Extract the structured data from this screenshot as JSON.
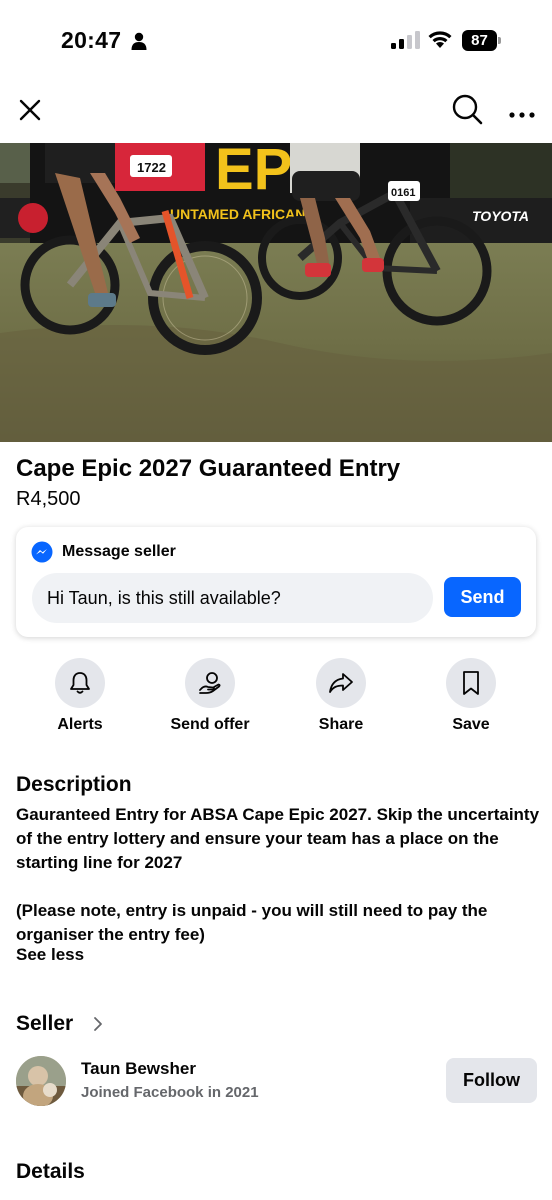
{
  "status_bar": {
    "time": "20:47",
    "battery": "87"
  },
  "listing": {
    "title": "Cape Epic 2027 Guaranteed Entry",
    "price": "R4,500"
  },
  "message_seller": {
    "title": "Message seller",
    "input_value": "Hi Taun, is this still available?",
    "send_label": "Send"
  },
  "actions": [
    {
      "label": "Alerts",
      "icon": "bell-icon"
    },
    {
      "label": "Send offer",
      "icon": "send-offer-icon"
    },
    {
      "label": "Share",
      "icon": "share-icon"
    },
    {
      "label": "Save",
      "icon": "bookmark-icon"
    }
  ],
  "description": {
    "heading": "Description",
    "paragraph_1": "Gauranteed Entry for ABSA Cape Epic 2027. Skip the uncertainty of the entry lottery and ensure your team has a place on the starting line for 2027",
    "paragraph_2": "(Please note, entry is unpaid - you will still need to pay the organiser the entry fee)",
    "see_less": "See less"
  },
  "seller": {
    "heading": "Seller",
    "name": "Taun Bewsher",
    "joined": "Joined Facebook in 2021",
    "follow_label": "Follow"
  },
  "details": {
    "heading": "Details"
  },
  "photo": {
    "banner_text": "EPIC",
    "banner_subtext": "UNTAMED AFRICAN",
    "sponsor_text": "TOYOTA",
    "bib_left": "1722",
    "bib_right": "0161"
  },
  "colors": {
    "accent": "#0866ff",
    "button_gray": "#e4e6eb",
    "secondary_text": "#65676b"
  }
}
